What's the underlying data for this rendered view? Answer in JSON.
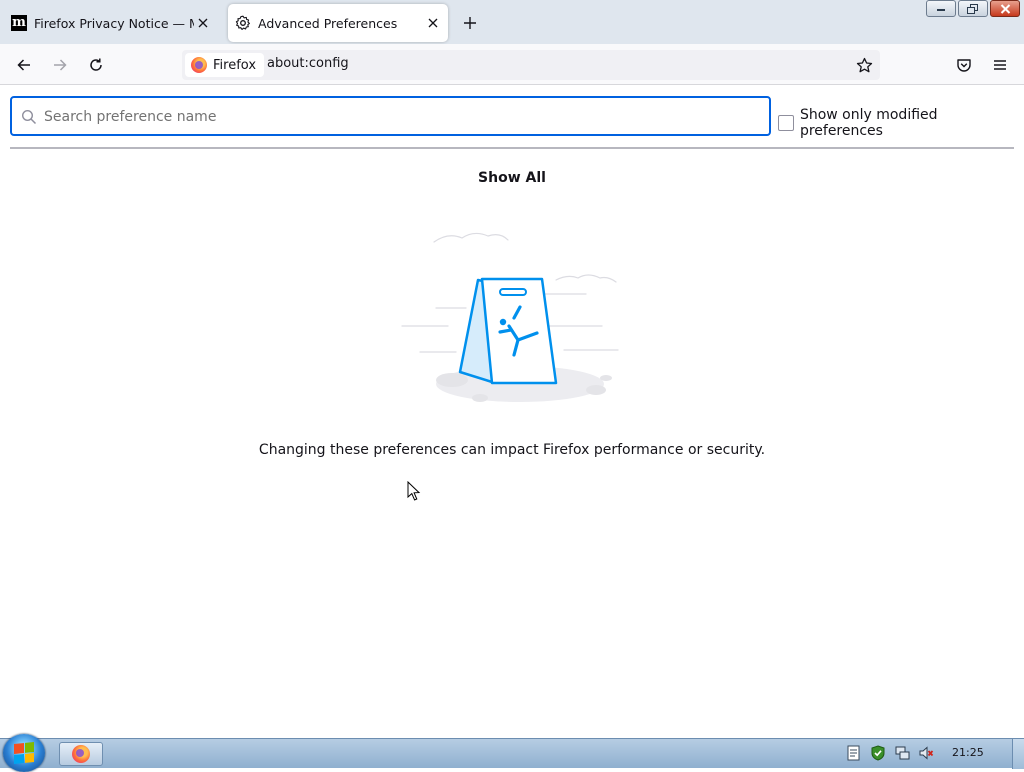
{
  "window": {
    "tabs": [
      {
        "title": "Firefox Privacy Notice — Mozilla",
        "favicon": "mozilla-m-icon",
        "active": false
      },
      {
        "title": "Advanced Preferences",
        "favicon": "gear-icon",
        "active": true
      }
    ]
  },
  "navbar": {
    "identity_label": "Firefox",
    "url": "about:config"
  },
  "config": {
    "search_placeholder": "Search preference name",
    "search_value": "",
    "modified_only_label": "Show only modified preferences",
    "modified_only_checked": false,
    "show_all_label": "Show All",
    "warning_text": "Changing these preferences can impact Firefox performance or security."
  },
  "taskbar": {
    "clock": "21:25",
    "tray_icons": [
      "document-icon",
      "shield-check-icon",
      "network-icon",
      "volume-muted-icon"
    ]
  },
  "colors": {
    "accent": "#0061e0",
    "illustration_blue": "#0090ed",
    "tabstrip": "#dfe6ee"
  }
}
